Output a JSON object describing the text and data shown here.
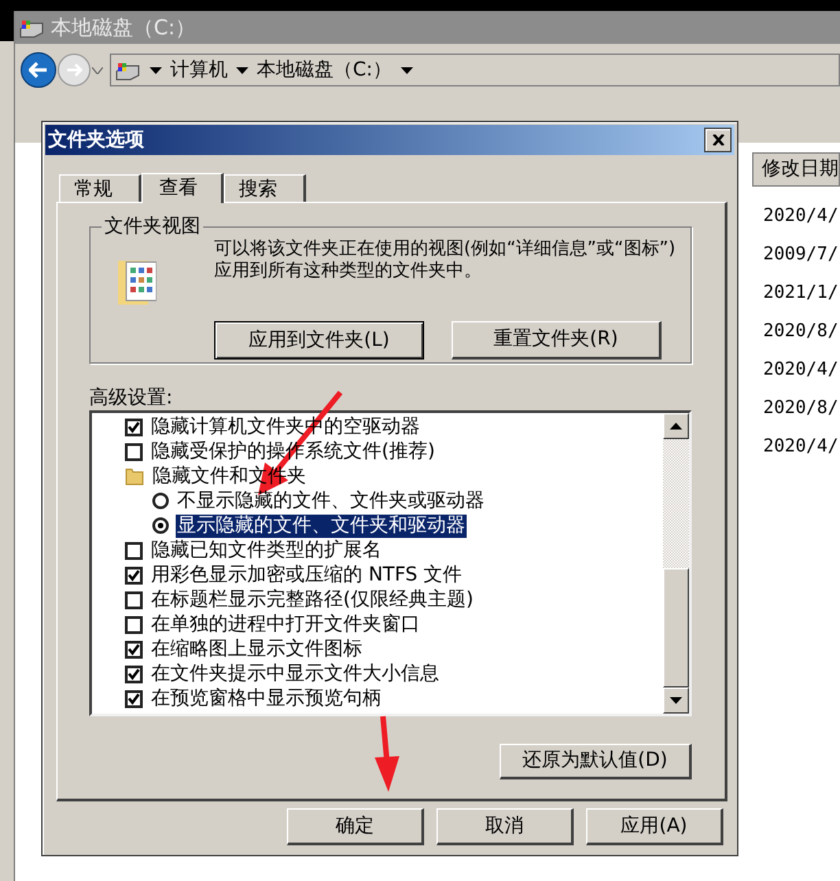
{
  "explorer": {
    "title": "本地磁盘（C:）",
    "breadcrumb": [
      "计算机",
      "本地磁盘（C:）"
    ],
    "columns": [
      "修改日期"
    ],
    "rows": [
      {
        "modified": "2020/4/"
      },
      {
        "modified": "2009/7/"
      },
      {
        "modified": "2021/1/"
      },
      {
        "modified": "2020/8/"
      },
      {
        "modified": "2020/4/"
      },
      {
        "modified": "2020/8/"
      },
      {
        "modified": "2020/4/"
      }
    ]
  },
  "dialog": {
    "title": "文件夹选项",
    "tabs": [
      {
        "label": "常规",
        "selected": false
      },
      {
        "label": "查看",
        "selected": true
      },
      {
        "label": "搜索",
        "selected": false
      }
    ],
    "group": {
      "title": "文件夹视图",
      "description": "可以将该文件夹正在使用的视图(例如“详细信息”或“图标”)应用到所有这种类型的文件夹中。",
      "buttons": [
        {
          "label": "应用到文件夹(L)",
          "default": true
        },
        {
          "label": "重置文件夹(R)",
          "default": false
        }
      ]
    },
    "advanced_label": "高级设置:",
    "settings": [
      {
        "kind": "checkbox",
        "label": "隐藏计算机文件夹中的空驱动器",
        "checked": true
      },
      {
        "kind": "checkbox",
        "label": "隐藏受保护的操作系统文件(推荐)",
        "checked": false
      },
      {
        "kind": "folder",
        "label": "隐藏文件和文件夹",
        "children": [
          {
            "kind": "radio",
            "label": "不显示隐藏的文件、文件夹或驱动器",
            "selected": false
          },
          {
            "kind": "radio",
            "label": "显示隐藏的文件、文件夹和驱动器",
            "selected": true
          }
        ]
      },
      {
        "kind": "checkbox",
        "label": "隐藏已知文件类型的扩展名",
        "checked": false
      },
      {
        "kind": "checkbox",
        "label": "用彩色显示加密或压缩的 NTFS 文件",
        "checked": true
      },
      {
        "kind": "checkbox",
        "label": "在标题栏显示完整路径(仅限经典主题)",
        "checked": false
      },
      {
        "kind": "checkbox",
        "label": "在单独的进程中打开文件夹窗口",
        "checked": false
      },
      {
        "kind": "checkbox",
        "label": "在缩略图上显示文件图标",
        "checked": true
      },
      {
        "kind": "checkbox",
        "label": "在文件夹提示中显示文件大小信息",
        "checked": true
      },
      {
        "kind": "checkbox",
        "label": "在预览窗格中显示预览句柄",
        "checked": true
      }
    ],
    "restore_button": "还原为默认值(D)",
    "buttons": [
      {
        "label": "确定"
      },
      {
        "label": "取消"
      },
      {
        "label": "应用(A)"
      }
    ]
  }
}
